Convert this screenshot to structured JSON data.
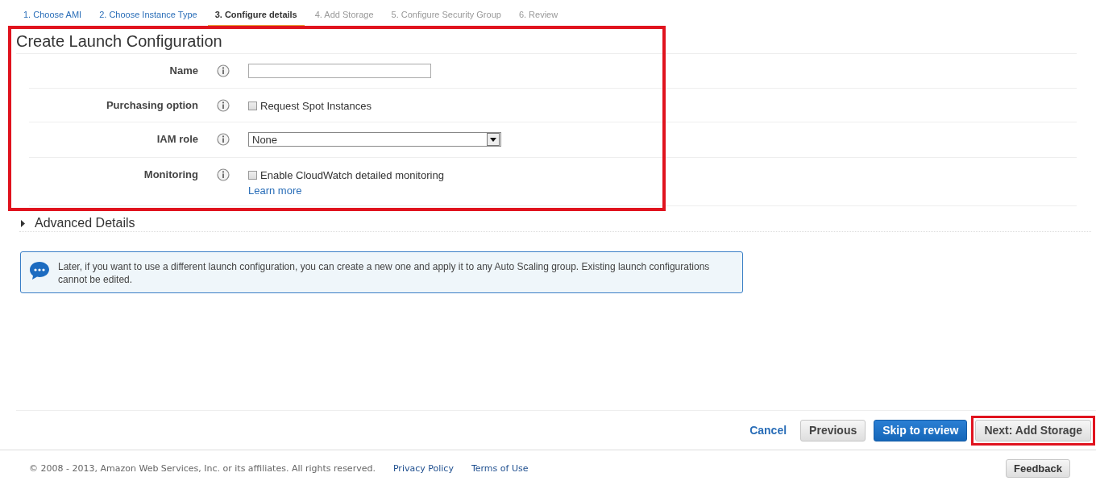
{
  "steps": [
    {
      "label": "1. Choose AMI",
      "selected": false,
      "visited": true
    },
    {
      "label": "2. Choose Instance Type",
      "selected": false,
      "visited": true
    },
    {
      "label": "3. Configure details",
      "selected": true,
      "visited": true
    },
    {
      "label": "4. Add Storage",
      "selected": false,
      "visited": false
    },
    {
      "label": "5. Configure Security Group",
      "selected": false,
      "visited": false
    },
    {
      "label": "6. Review",
      "selected": false,
      "visited": false
    }
  ],
  "form": {
    "title": "Create Launch Configuration",
    "highlighted": true,
    "fields": [
      {
        "kind": "text",
        "label": "Name"
      },
      {
        "kind": "checkbox",
        "label": "Purchasing option",
        "option": "Request Spot Instances",
        "checked": false
      },
      {
        "kind": "select",
        "label": "IAM role",
        "value": "None"
      },
      {
        "kind": "checkbox",
        "label": "Monitoring",
        "option": "Enable CloudWatch detailed monitoring",
        "checked": false,
        "link": "Learn more"
      }
    ]
  },
  "advanced": {
    "label": "Advanced Details",
    "expanded": false
  },
  "note": {
    "text": "Later, if you want to use a different launch configuration, you can create a new one and apply it to any Auto Scaling group. Existing launch configurations cannot be edited."
  },
  "actions": {
    "cancel": "Cancel",
    "buttons": [
      {
        "label": "Previous",
        "kind": "secondary",
        "highlighted": false
      },
      {
        "label": "Skip to review",
        "kind": "primary",
        "highlighted": false
      },
      {
        "label": "Next: Add Storage",
        "kind": "secondary",
        "highlighted": true
      }
    ]
  },
  "footer": {
    "copyright": "© 2008 - 2013, Amazon Web Services, Inc. or its affiliates. All rights reserved.",
    "links": [
      "Privacy Policy",
      "Terms of Use"
    ],
    "feedback": "Feedback"
  }
}
